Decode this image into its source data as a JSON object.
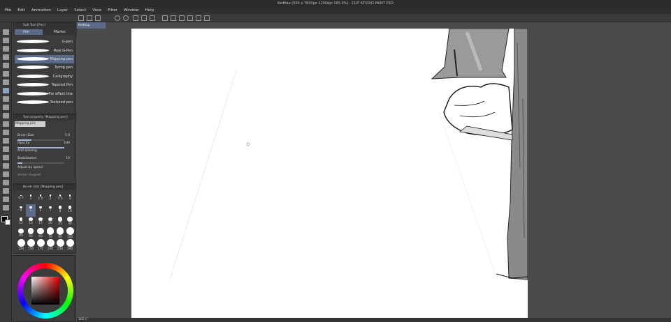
{
  "window": {
    "title": "KedKop (500 x 7600px 1200dpi 165.0%) - CLIP STUDIO PAINT PRO"
  },
  "menu": [
    "File",
    "Edit",
    "Animation",
    "Layer",
    "Select",
    "View",
    "Filter",
    "Window",
    "Help"
  ],
  "subtool": {
    "header": "Sub Tool [Pen]",
    "tabs": [
      "Pen",
      "Marker"
    ],
    "brushes": [
      "G-pen",
      "Real G-Pen",
      "Mapping pen",
      "Turnip pen",
      "Calligraphy",
      "Tapered Pen",
      "For effect line",
      "Textured pen"
    ],
    "selected_brush": "Mapping pen"
  },
  "tool_property": {
    "header": "Tool property [Mapping pen]",
    "name": "Mapping pen",
    "rows": [
      {
        "label": "Brush Size",
        "value": "5.0"
      },
      {
        "label": "Opacity",
        "value": "100"
      },
      {
        "label": "Anti-aliasing",
        "value": ""
      },
      {
        "label": "Stabilization",
        "value": "10"
      }
    ],
    "adjust_speed": "Adjust by speed",
    "vector_magnet": "Vector magnet"
  },
  "brush_size": {
    "header": "Brush size [Mapping pen]",
    "sizes": [
      "0.7",
      "1",
      "1.5",
      "2",
      "2.5",
      "3",
      "4",
      "5",
      "6",
      "7",
      "8",
      "10",
      "12",
      "15",
      "17",
      "20",
      "25",
      "30",
      "40",
      "50",
      "60",
      "70",
      "80",
      "100",
      "120",
      "150",
      "170",
      "200",
      "250",
      "300"
    ],
    "selected": "5"
  },
  "document": {
    "tab": "KedKop",
    "zoom": "165.0"
  },
  "colors": {
    "accent": "#5a6a88",
    "main_color": "#000000",
    "sub_color": "#ffffff"
  }
}
